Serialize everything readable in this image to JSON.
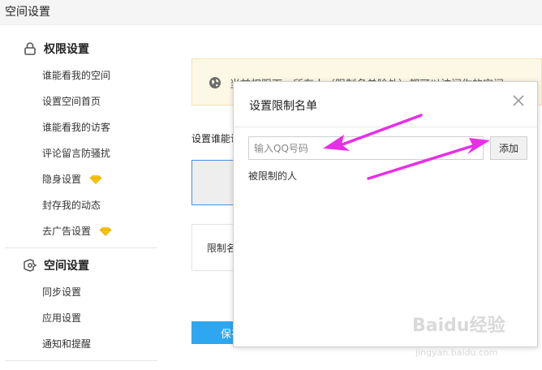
{
  "header": {
    "title": "空间设置"
  },
  "sidebar": {
    "section1": {
      "label": "权限设置",
      "icon": "lock-icon"
    },
    "items1": [
      {
        "label": "谁能看我的空间"
      },
      {
        "label": "设置空间首页"
      },
      {
        "label": "谁能看我的访客"
      },
      {
        "label": "评论留言防骚扰"
      },
      {
        "label": "隐身设置",
        "badge": "diamond-icon"
      },
      {
        "label": "封存我的动态"
      },
      {
        "label": "去广告设置",
        "badge": "diamond-icon"
      }
    ],
    "section2": {
      "label": "空间设置",
      "icon": "settings-icon"
    },
    "items2": [
      {
        "label": "同步设置"
      },
      {
        "label": "应用设置"
      },
      {
        "label": "通知和提醒"
      }
    ]
  },
  "main": {
    "banner": {
      "text": "当前权限下，所有人（限制名单除外）都可以访问你的空间",
      "icon": "globe-icon"
    },
    "setting_label": "设置谁能访问",
    "restricted_box_label": "限制名单",
    "save_label": "保存"
  },
  "modal": {
    "title": "设置限制名单",
    "input": {
      "placeholder": "输入QQ号码",
      "value": ""
    },
    "add_label": "添加",
    "restricted_label": "被限制的人"
  },
  "colors": {
    "accent_blue": "#2ea7f0",
    "diamond_gold": "#f5c400",
    "arrow_magenta": "#e82ee8",
    "banner_bg": "#fdf8e6"
  },
  "watermark": {
    "text": "Baidu经验",
    "sub": "jingyan.baidu.com"
  }
}
